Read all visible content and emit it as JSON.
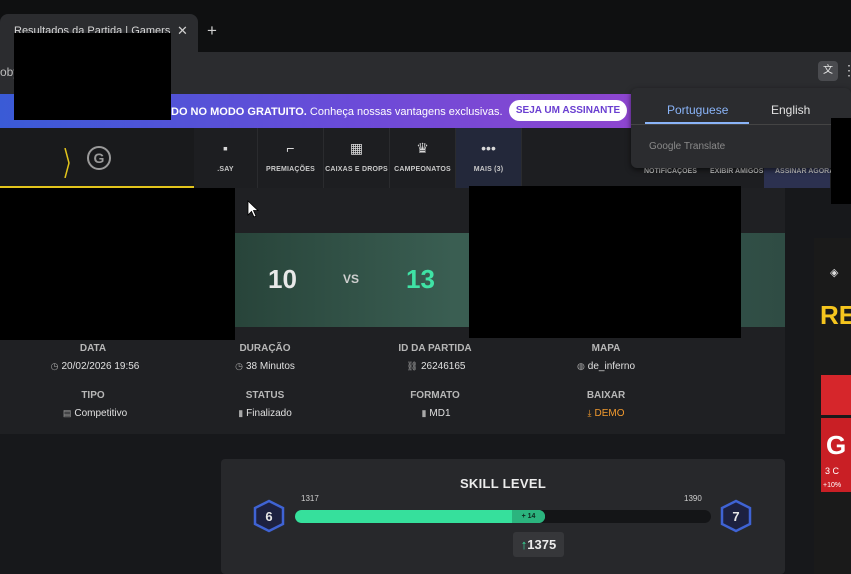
{
  "browser": {
    "tab_title": "Resultados da Partida | Gamers",
    "new_tab": "+",
    "close": "✕",
    "url": "oby",
    "menu_dots": "⋮"
  },
  "promo": {
    "text_bold": "DO NO MODO GRATUITO.",
    "text": " Conheça nossas vantagens exclusivas.",
    "button": "SEJA UM ASSINANTE"
  },
  "translate_popup": {
    "lang_from": "Portuguese",
    "lang_to": "English",
    "brand": "Google Translate"
  },
  "nav": {
    "items": [
      {
        "label": ".SAY",
        "icon": "chat-icon"
      },
      {
        "label": "PREMIAÇÕES",
        "icon": "gun-icon"
      },
      {
        "label": "CAIXAS E DROPS",
        "icon": "box-icon"
      },
      {
        "label": "CAMPEONATOS",
        "icon": "trophy-icon"
      },
      {
        "label": "MAIS (3)",
        "icon": "more-icon"
      }
    ],
    "right": [
      "NOTIFICAÇÕES",
      "EXIBIR AMIGOS",
      "ASSINAR AGORA"
    ]
  },
  "match": {
    "score_a": "10",
    "vs": "VS",
    "score_b": "13",
    "info": [
      {
        "label": "DATA",
        "value": "20/02/2026 19:56",
        "icon": "clock-icon"
      },
      {
        "label": "DURAÇÃO",
        "value": "38 Minutos",
        "icon": "clock-icon"
      },
      {
        "label": "ID DA PARTIDA",
        "value": "26246165",
        "icon": "link-icon"
      },
      {
        "label": "MAPA",
        "value": "de_inferno",
        "icon": "globe-icon"
      },
      {
        "label": "TIPO",
        "value": "Competitivo",
        "icon": "clipboard-icon"
      },
      {
        "label": "STATUS",
        "value": "Finalizado",
        "icon": "bars-icon"
      },
      {
        "label": "FORMATO",
        "value": "MD1",
        "icon": "bars-icon"
      },
      {
        "label": "BAIXAR",
        "value": "DEMO",
        "icon": "download-icon"
      }
    ]
  },
  "skill": {
    "title": "SKILL LEVEL",
    "min": "1317",
    "max": "1390",
    "gain": "+ 14",
    "current": "1375",
    "level_left": "6",
    "level_right": "7",
    "progress_fraction": 0.6,
    "gain_fraction": 0.08
  },
  "ad": {
    "yellow": "RE",
    "g": "G",
    "t1": "3 C",
    "t2": "+10%"
  },
  "colors": {
    "accent_green": "#36e09c",
    "promo_start": "#3a5bd6",
    "promo_end": "#8f45cf",
    "logo_yellow": "#e2c41c",
    "demo_orange": "#f29a2e"
  }
}
